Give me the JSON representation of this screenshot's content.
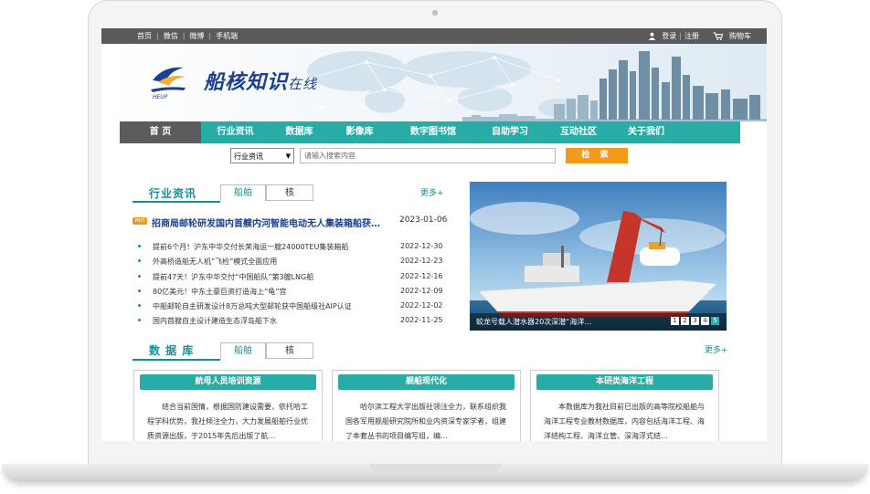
{
  "topbar": {
    "links": [
      "首页",
      "微信",
      "微博",
      "手机端"
    ],
    "login": "登录",
    "register": "注册",
    "cart": "购物车"
  },
  "brand": {
    "name": "船核知识",
    "suffix": "在线",
    "logo_lettering": "HEUP"
  },
  "nav": {
    "items": [
      "首 页",
      "行业资讯",
      "数据库",
      "影像库",
      "数字图书馆",
      "自助学习",
      "互动社区",
      "关于我们"
    ]
  },
  "search": {
    "category": "行业资讯",
    "placeholder": "请输入搜索内容",
    "button": "检 索"
  },
  "industry": {
    "title": "行业资讯",
    "tabs": [
      "船舶",
      "核"
    ],
    "more": "更多+",
    "featured": {
      "badge": "HOT",
      "title": "招商局邮轮研发国内首艘内河智能电动无人集装箱船获…",
      "date": "2023-01-06"
    },
    "news": [
      {
        "title": "提前6个月！沪东中华交付长荣海运一艘24000TEU集装箱船",
        "date": "2022-12-30"
      },
      {
        "title": "外高桥造船无人机“飞检”模式全面应用",
        "date": "2022-12-23"
      },
      {
        "title": "提前47天！沪东中华交付“中国船队”第3艘LNG船",
        "date": "2022-12-16"
      },
      {
        "title": "80亿美元！中东土豪巨资打造海上“龟”宫",
        "date": "2022-12-09"
      },
      {
        "title": "中船邮轮自主研发设计8万总吨大型邮轮获中国船级社AIP认证",
        "date": "2022-12-02"
      },
      {
        "title": "国内首艘自主设计建造生态浮岛船下水",
        "date": "2022-11-25"
      }
    ],
    "slide_caption": "蛟龙号载人潜水器20次深潜“海洋…",
    "slide_pages": [
      "1",
      "2",
      "3",
      "4",
      "5"
    ]
  },
  "database": {
    "title": "数 据 库",
    "tabs": [
      "船舶",
      "核"
    ],
    "more": "更多+",
    "cards": [
      {
        "title": "航母人员培训资源",
        "body": "结合当前国情，根据国防建设需要，依托哈工程学科优势，我社倾注全力，大力发展船舶行业优质资源出版，于2015年先后出版了航…"
      },
      {
        "title": "舰船现代化",
        "body": "哈尔滨工程大学出版社领注全力，联系组织我国各军用舰船研究院所和业内资深专家学者，组建了本套丛书的项目编写组，编…"
      },
      {
        "title": "本研类海洋工程",
        "body": "本数据库为我社目前已出版的高等院校船舶与海洋工程专业教材数据库，内容包括海洋工程、海洋结构工程、海洋立管、深海浮式结…"
      }
    ]
  },
  "colors": {
    "accent": "#2aaca6",
    "title_teal": "#1a8f93",
    "search_button": "#f29a1a",
    "topbar": "#5a5a5a",
    "nav_home": "#5c5c5c"
  }
}
